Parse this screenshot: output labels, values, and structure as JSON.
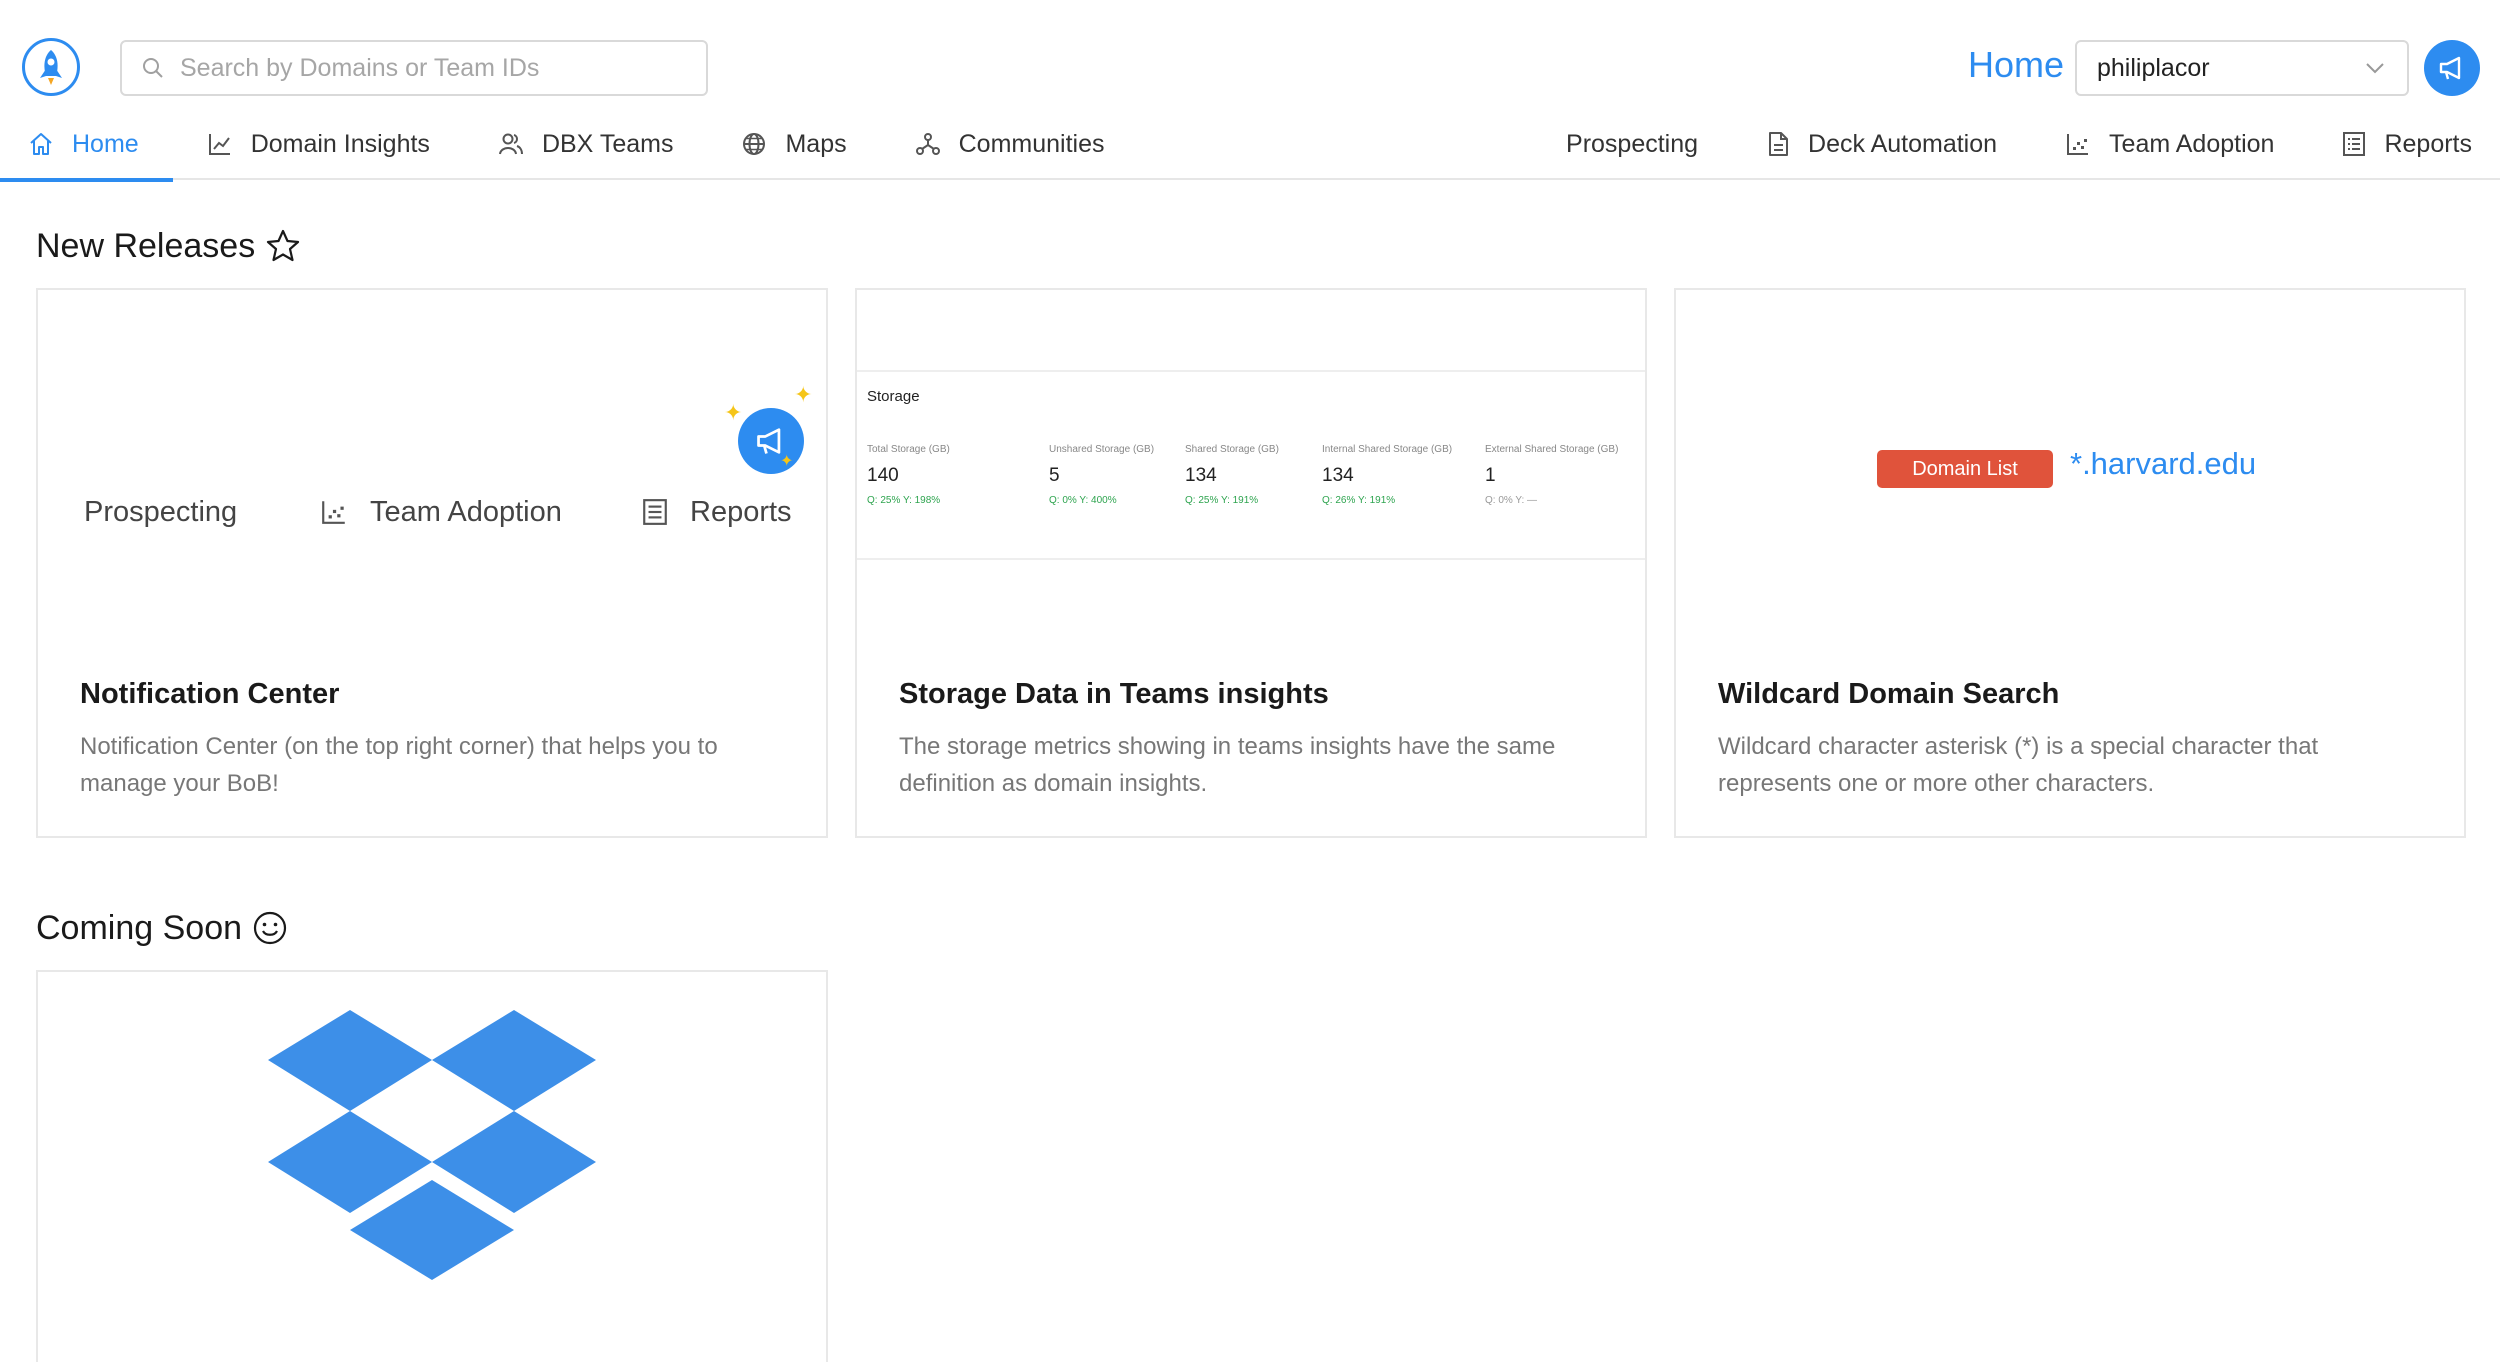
{
  "search": {
    "placeholder": "Search by Domains or Team IDs"
  },
  "header": {
    "home_label": "Home",
    "user": "philiplacor"
  },
  "nav_left": [
    {
      "label": "Home",
      "icon": "home-icon",
      "active": true
    },
    {
      "label": "Domain Insights",
      "icon": "line-chart-icon"
    },
    {
      "label": "DBX Teams",
      "icon": "team-icon"
    },
    {
      "label": "Maps",
      "icon": "globe-icon"
    },
    {
      "label": "Communities",
      "icon": "network-icon"
    }
  ],
  "nav_right": [
    {
      "label": "Prospecting",
      "icon": ""
    },
    {
      "label": "Deck Automation",
      "icon": "document-icon"
    },
    {
      "label": "Team Adoption",
      "icon": "dot-chart-icon"
    },
    {
      "label": "Reports",
      "icon": "list-icon"
    }
  ],
  "new_releases": {
    "title": "New Releases",
    "cards": [
      {
        "title": "Notification Center",
        "desc": "Notification Center (on the top right corner) that helps you to manage your BoB!",
        "preview": {
          "items": [
            "Prospecting",
            "Team Adoption",
            "Reports"
          ]
        }
      },
      {
        "title": "Storage Data in Teams insights",
        "desc": "The storage metrics showing in teams insights have the same definition as domain insights.",
        "preview": {
          "heading": "Storage",
          "columns": [
            {
              "label": "Total Storage (GB)",
              "value": "140",
              "delta": "Q: 25%  Y: 198%",
              "positive": true
            },
            {
              "label": "Unshared Storage (GB)",
              "value": "5",
              "delta": "Q: 0%  Y: 400%",
              "positive": true
            },
            {
              "label": "Shared Storage (GB)",
              "value": "134",
              "delta": "Q: 25%  Y: 191%",
              "positive": true
            },
            {
              "label": "Internal Shared Storage (GB)",
              "value": "134",
              "delta": "Q: 26%  Y: 191%",
              "positive": true
            },
            {
              "label": "External Shared Storage (GB)",
              "value": "1",
              "delta": "Q: 0%  Y: —",
              "positive": false
            }
          ]
        }
      },
      {
        "title": "Wildcard Domain Search",
        "desc": "Wildcard character asterisk (*) is a special character that represents one or more other characters.",
        "preview": {
          "badge": "Domain List",
          "text": "*.harvard.edu"
        }
      }
    ]
  },
  "coming_soon": {
    "title": "Coming Soon"
  },
  "colors": {
    "accent": "#2d8cf0",
    "badge": "#e0533b",
    "positive": "#2ea44f"
  }
}
